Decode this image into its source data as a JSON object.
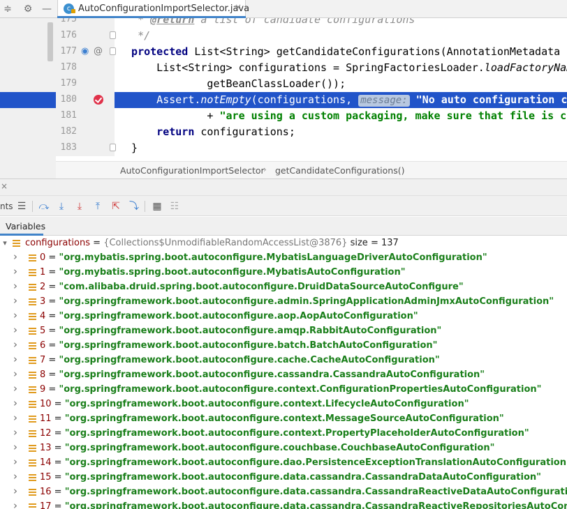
{
  "tab": {
    "class_badge": "c",
    "filename": "AutoConfigurationImportSelector.java",
    "close": "×"
  },
  "editor": {
    "lines": [
      {
        "n": "175",
        "parts": [
          [
            "com",
            "   * "
          ],
          [
            "com-tag",
            "@return"
          ],
          [
            "com",
            " a list of candidate configurations"
          ]
        ]
      },
      {
        "n": "176",
        "parts": [
          [
            "com",
            "   */"
          ]
        ]
      },
      {
        "n": "177",
        "parts": [
          [
            "kw",
            "  protected "
          ],
          [
            "",
            "List<String> getCandidateConfigurations(AnnotationMetadata m"
          ]
        ]
      },
      {
        "n": "178",
        "parts": [
          [
            "",
            "      List<String> configurations = SpringFactoriesLoader."
          ],
          [
            "itl",
            "loadFactoryNam"
          ]
        ]
      },
      {
        "n": "179",
        "parts": [
          [
            "",
            "              getBeanClassLoader());"
          ]
        ]
      },
      {
        "n": "180",
        "parts": [
          [
            "",
            "      Assert."
          ],
          [
            "itl",
            "notEmpty"
          ],
          [
            "",
            "(configurations, "
          ],
          [
            "hint",
            "message:"
          ],
          [
            "str",
            " \"No auto configuration cl"
          ]
        ]
      },
      {
        "n": "181",
        "parts": [
          [
            "",
            "              + "
          ],
          [
            "str",
            "\"are using a custom packaging, make sure that file is co"
          ]
        ]
      },
      {
        "n": "182",
        "parts": [
          [
            "kw",
            "      return "
          ],
          [
            "",
            "configurations;"
          ]
        ]
      },
      {
        "n": "183",
        "parts": [
          [
            "",
            "  }"
          ]
        ]
      }
    ]
  },
  "breadcrumb": {
    "class": "AutoConfigurationImportSelector",
    "sep": "›",
    "method": "getCandidateConfigurations()"
  },
  "debug": {
    "close": "×",
    "tab_fragment": "nts",
    "variables_tab": "Variables"
  },
  "variables": {
    "root": {
      "name": "configurations",
      "eq": " = ",
      "obj": "{Collections$UnmodifiableRandomAccessList@3876}",
      "size": "  size = 137"
    },
    "items": [
      {
        "i": "0",
        "v": "\"org.mybatis.spring.boot.autoconfigure.MybatisLanguageDriverAutoConfiguration\""
      },
      {
        "i": "1",
        "v": "\"org.mybatis.spring.boot.autoconfigure.MybatisAutoConfiguration\""
      },
      {
        "i": "2",
        "v": "\"com.alibaba.druid.spring.boot.autoconfigure.DruidDataSourceAutoConfigure\""
      },
      {
        "i": "3",
        "v": "\"org.springframework.boot.autoconfigure.admin.SpringApplicationAdminJmxAutoConfiguration\""
      },
      {
        "i": "4",
        "v": "\"org.springframework.boot.autoconfigure.aop.AopAutoConfiguration\""
      },
      {
        "i": "5",
        "v": "\"org.springframework.boot.autoconfigure.amqp.RabbitAutoConfiguration\""
      },
      {
        "i": "6",
        "v": "\"org.springframework.boot.autoconfigure.batch.BatchAutoConfiguration\""
      },
      {
        "i": "7",
        "v": "\"org.springframework.boot.autoconfigure.cache.CacheAutoConfiguration\""
      },
      {
        "i": "8",
        "v": "\"org.springframework.boot.autoconfigure.cassandra.CassandraAutoConfiguration\""
      },
      {
        "i": "9",
        "v": "\"org.springframework.boot.autoconfigure.context.ConfigurationPropertiesAutoConfiguration\""
      },
      {
        "i": "10",
        "v": "\"org.springframework.boot.autoconfigure.context.LifecycleAutoConfiguration\""
      },
      {
        "i": "11",
        "v": "\"org.springframework.boot.autoconfigure.context.MessageSourceAutoConfiguration\""
      },
      {
        "i": "12",
        "v": "\"org.springframework.boot.autoconfigure.context.PropertyPlaceholderAutoConfiguration\""
      },
      {
        "i": "13",
        "v": "\"org.springframework.boot.autoconfigure.couchbase.CouchbaseAutoConfiguration\""
      },
      {
        "i": "14",
        "v": "\"org.springframework.boot.autoconfigure.dao.PersistenceExceptionTranslationAutoConfiguration\""
      },
      {
        "i": "15",
        "v": "\"org.springframework.boot.autoconfigure.data.cassandra.CassandraDataAutoConfiguration\""
      },
      {
        "i": "16",
        "v": "\"org.springframework.boot.autoconfigure.data.cassandra.CassandraReactiveDataAutoConfiguration\""
      },
      {
        "i": "17",
        "v": "\"org.springframework.boot.autoconfigure.data.cassandra.CassandraReactiveRepositoriesAutoConfiguration\""
      }
    ]
  },
  "colors": {
    "accent": "#4083c9",
    "selection": "#2154c9",
    "string": "#008000",
    "keyword": "#000080",
    "breakpoint": "#e0324a"
  }
}
